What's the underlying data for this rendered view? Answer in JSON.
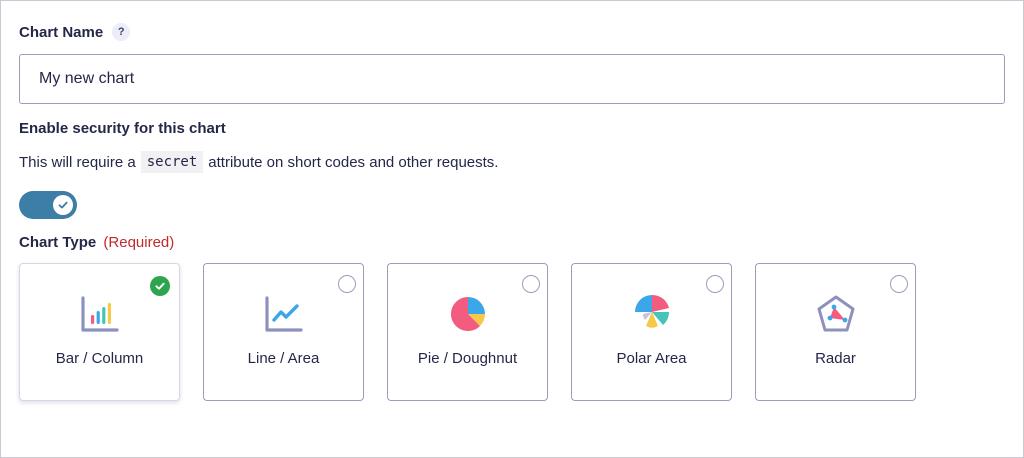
{
  "chart_name": {
    "label": "Chart Name",
    "help_icon_text": "?",
    "value": "My new chart"
  },
  "security": {
    "title": "Enable security for this chart",
    "desc_before": "This will require a",
    "code": "secret",
    "desc_after": "attribute on short codes and other requests.",
    "toggle_on": true
  },
  "chart_type": {
    "label": "Chart Type",
    "required": "(Required)",
    "options": [
      {
        "label": "Bar / Column",
        "icon": "bar-chart-icon",
        "selected": true
      },
      {
        "label": "Line / Area",
        "icon": "line-chart-icon",
        "selected": false
      },
      {
        "label": "Pie / Doughnut",
        "icon": "pie-chart-icon",
        "selected": false
      },
      {
        "label": "Polar Area",
        "icon": "polar-area-chart-icon",
        "selected": false
      },
      {
        "label": "Radar",
        "icon": "radar-chart-icon",
        "selected": false
      }
    ]
  },
  "colors": {
    "toggle": "#3d7ea6",
    "selected_check": "#2ea44f",
    "required": "#c02b2b",
    "border": "#9b9ebc"
  }
}
